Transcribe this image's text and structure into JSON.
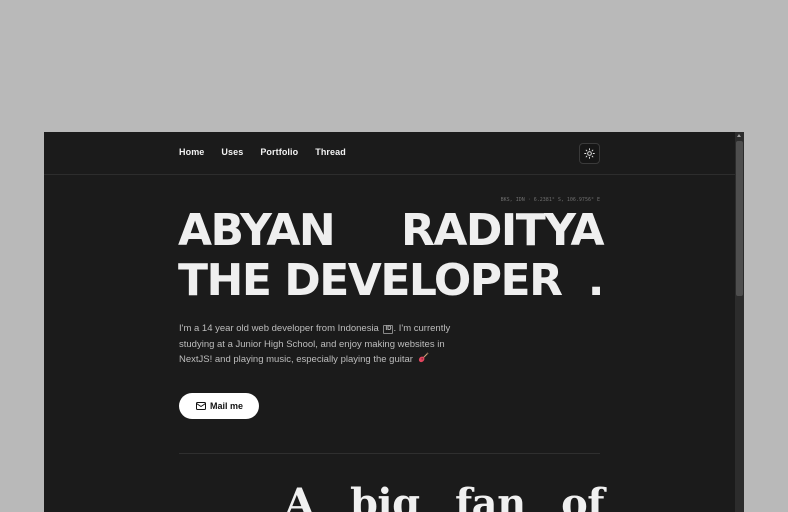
{
  "nav": {
    "links": [
      "Home",
      "Uses",
      "Portfolio",
      "Thread"
    ],
    "theme_icon": "sun-icon"
  },
  "location": {
    "coords": "BKS, IDN · 6.2381° S, 106.9756° E"
  },
  "hero": {
    "line1": [
      "ABYAN",
      "RADITYA"
    ],
    "line2": [
      "THE DEVELOPER",
      "."
    ]
  },
  "bio": {
    "text_before_flag": "I'm a 14 year old web developer from Indonesia",
    "flag_code": "ID",
    "text_after_flag": ". I'm currently studying at a Junior High School, and enjoy making websites in NextJS! and playing music, especially playing the guitar",
    "emoji_icon": "guitar-icon"
  },
  "cta": {
    "label": "Mail me",
    "icon": "mail-icon"
  },
  "section": {
    "words": [
      "A",
      "big",
      "fan",
      "of"
    ]
  },
  "colors": {
    "background": "#1b1b1b",
    "text": "#efefef",
    "button_bg": "#ffffff"
  }
}
